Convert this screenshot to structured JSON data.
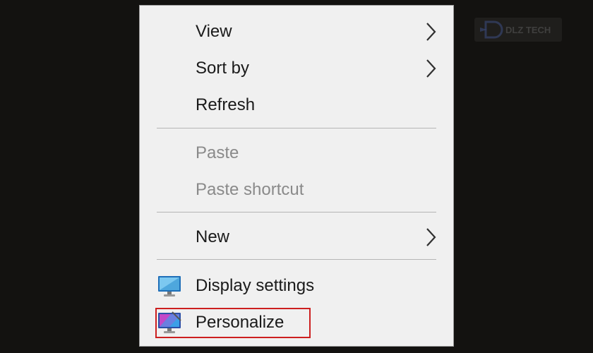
{
  "context_menu": {
    "items": [
      {
        "label": "View",
        "enabled": true,
        "submenu": true
      },
      {
        "label": "Sort by",
        "enabled": true,
        "submenu": true
      },
      {
        "label": "Refresh",
        "enabled": true,
        "submenu": false
      },
      {
        "label": "Paste",
        "enabled": false,
        "submenu": false
      },
      {
        "label": "Paste shortcut",
        "enabled": false,
        "submenu": false
      },
      {
        "label": "New",
        "enabled": true,
        "submenu": true
      },
      {
        "label": "Display settings",
        "enabled": true,
        "submenu": false,
        "icon": "display-settings-icon"
      },
      {
        "label": "Personalize",
        "enabled": true,
        "submenu": false,
        "icon": "personalize-icon",
        "highlighted": true
      }
    ],
    "highlight_color": "#cc1f1f",
    "chevron_icon": "chevron-right-icon"
  },
  "watermark": {
    "text": "DLZ TECH",
    "icon": "dlz-tech-logo"
  }
}
